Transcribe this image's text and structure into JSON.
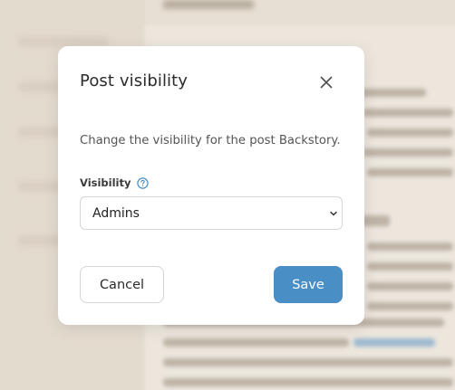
{
  "modal": {
    "title": "Post visibility",
    "description": "Change the visibility for the post Backstory.",
    "visibility_label": "Visibility",
    "visibility_value": "Admins",
    "cancel_label": "Cancel",
    "save_label": "Save"
  },
  "icons": {
    "close": "close-icon",
    "help": "help-circle-icon",
    "dropdown": "chevron-down-icon"
  },
  "colors": {
    "primary": "#4a8ec6",
    "backdrop": "#e7dfd3",
    "surface": "#ffffff"
  }
}
